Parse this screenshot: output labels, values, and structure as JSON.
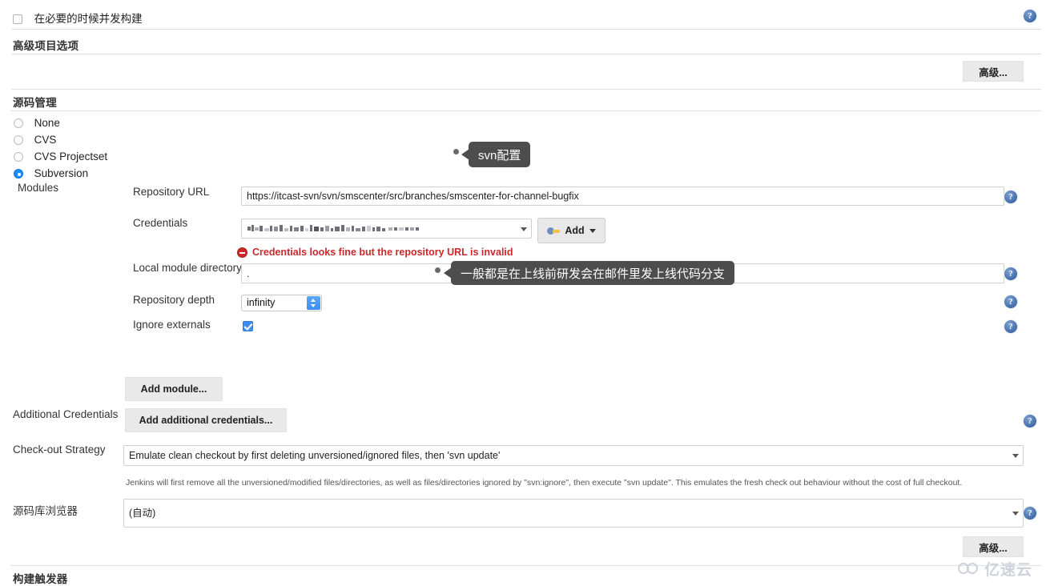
{
  "top": {
    "concurrent_build_label": "在必要的时候并发构建",
    "concurrent_build_checked": false
  },
  "advanced_project": {
    "section_title": "高级项目选项",
    "advanced_button": "高级..."
  },
  "scm": {
    "section_title": "源码管理",
    "options": [
      {
        "label": "None",
        "selected": false
      },
      {
        "label": "CVS",
        "selected": false
      },
      {
        "label": "CVS Projectset",
        "selected": false
      },
      {
        "label": "Subversion",
        "selected": true
      }
    ],
    "modules_label": "Modules",
    "repository_url": {
      "label": "Repository URL",
      "value": "https://itcast-svn/svn/smscenter/src/branches/smscenter-for-channel-bugfix"
    },
    "credentials": {
      "label": "Credentials",
      "value": "",
      "add_button": "Add",
      "error": "Credentials looks fine but the repository URL is invalid"
    },
    "local_module_directory": {
      "label": "Local module directory",
      "value": "."
    },
    "repository_depth": {
      "label": "Repository depth",
      "value": "infinity"
    },
    "ignore_externals": {
      "label": "Ignore externals",
      "checked": true
    },
    "add_module_button": "Add module...",
    "additional_credentials": {
      "label": "Additional Credentials",
      "button": "Add additional credentials..."
    },
    "checkout_strategy": {
      "label": "Check-out Strategy",
      "value": "Emulate clean checkout by first deleting unversioned/ignored files, then 'svn update'",
      "hint": "Jenkins will first remove all the unversioned/modified files/directories, as well as files/directories ignored by \"svn:ignore\", then execute \"svn update\". This emulates the fresh check out behaviour without the cost of full checkout."
    },
    "repository_browser": {
      "label": "源码库浏览器",
      "value": "(自动)"
    },
    "advanced_button": "高级..."
  },
  "build_triggers": {
    "section_title": "构建触发器"
  },
  "annotations": [
    {
      "text": "svn配置"
    },
    {
      "text": "一般都是在上线前研发会在邮件里发上线代码分支"
    }
  ],
  "watermark": {
    "text": "亿速云"
  },
  "colors": {
    "accent_blue": "#3e8ef7",
    "error_red": "#c9292b",
    "callout_bg": "#4d4d4d"
  }
}
